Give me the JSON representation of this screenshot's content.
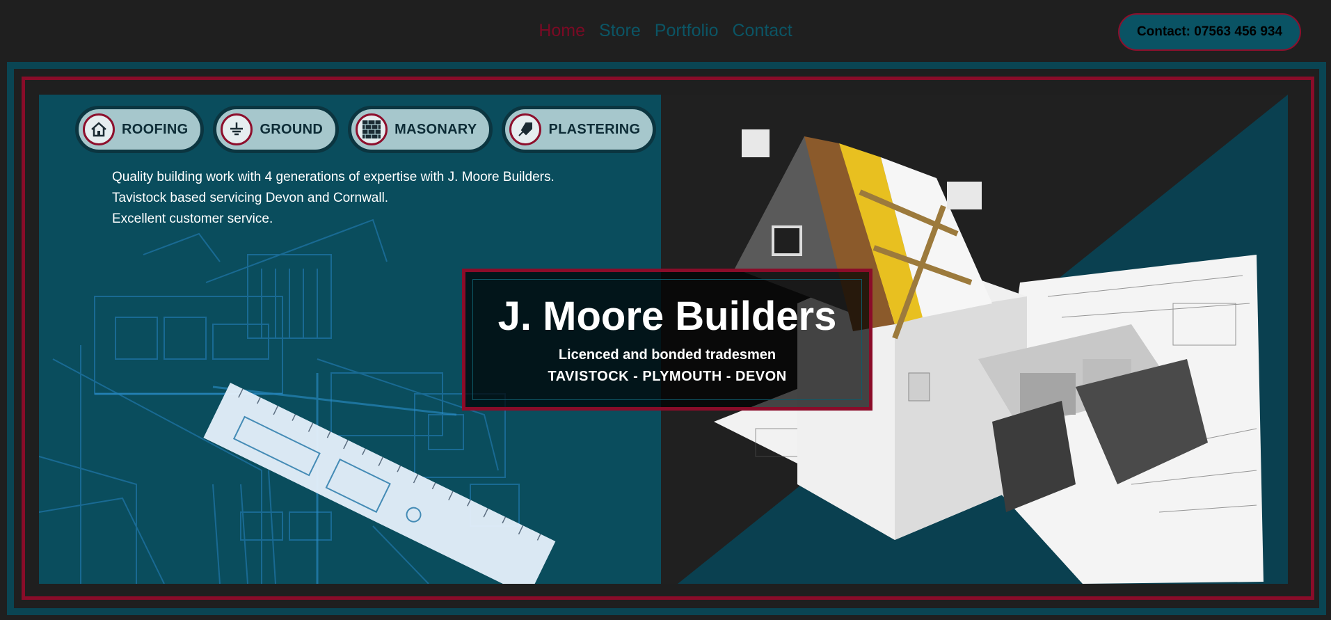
{
  "nav": {
    "items": [
      {
        "label": "Home",
        "active": true
      },
      {
        "label": "Store",
        "active": false
      },
      {
        "label": "Portfolio",
        "active": false
      },
      {
        "label": "Contact",
        "active": false
      }
    ],
    "contact_label": "Contact: 07563 456 934"
  },
  "services": [
    {
      "label": "ROOFING",
      "icon": "house-icon"
    },
    {
      "label": "GROUND",
      "icon": "ground-icon"
    },
    {
      "label": "MASONARY",
      "icon": "brick-icon"
    },
    {
      "label": "PLASTERING",
      "icon": "trowel-icon"
    }
  ],
  "about": {
    "line1": "Quality building work with 4 generations of expertise with J. Moore Builders.",
    "line2": "Tavistock based servicing Devon and Cornwall.",
    "line3": "Excellent customer service."
  },
  "hero": {
    "title": "J. Moore Builders",
    "subtitle": "Licenced and bonded tradesmen",
    "locations": "TAVISTOCK - PLYMOUTH - DEVON"
  },
  "colors": {
    "background": "#1f1f1f",
    "teal": "#0a4d5d",
    "accent_red": "#8a0c29",
    "nav_link": "#0b5565",
    "nav_active": "#7a0a24"
  }
}
